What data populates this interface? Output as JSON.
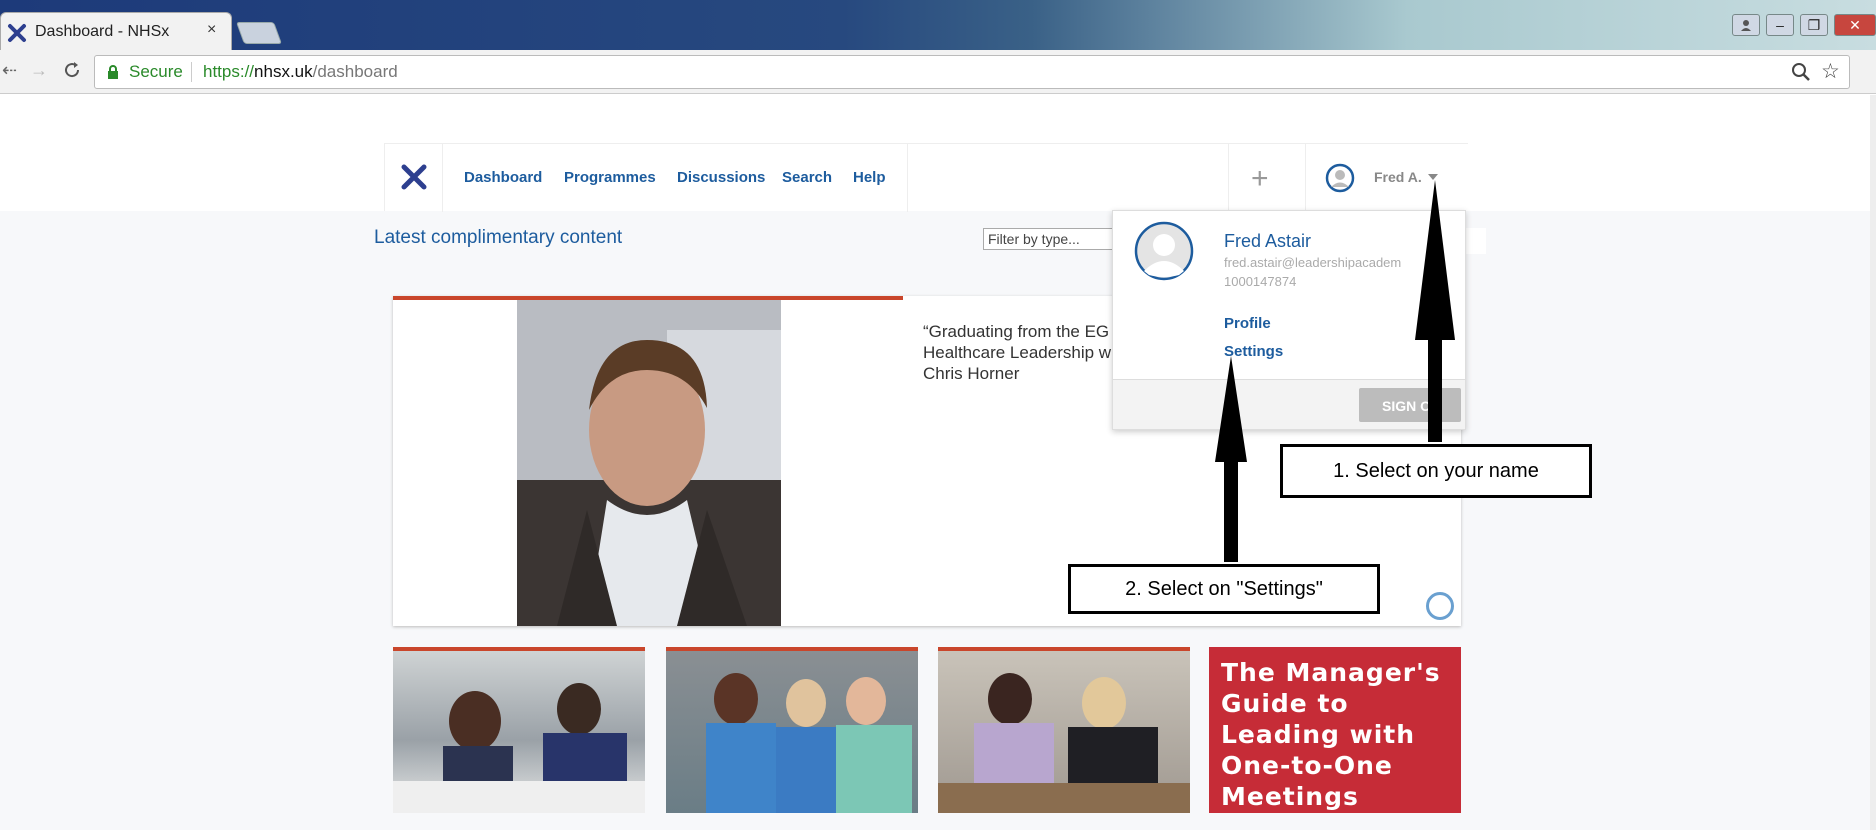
{
  "browser": {
    "tab_title": "Dashboard - NHSx",
    "tab_close": "×",
    "secure_label": "Secure",
    "url_scheme": "https://",
    "url_host": "nhsx.uk",
    "url_path": "/dashboard"
  },
  "nav": {
    "items": [
      "Dashboard",
      "Programmes",
      "Discussions",
      "Search",
      "Help"
    ],
    "add_label": "+",
    "user_short_name": "Fred A."
  },
  "main": {
    "section_title": "Latest complimentary content",
    "filter_placeholder": "Filter by type...",
    "hero_quote_lines": [
      "“Graduating from the EG",
      "Healthcare Leadership w",
      "Chris Horner"
    ],
    "card4_text": "The Manager's Guide to Leading with One-to-One Meetings"
  },
  "user_menu": {
    "name": "Fred Astair",
    "email": "fred.astair@leadershipacadem",
    "id_number": "1000147874",
    "profile_label": "Profile",
    "settings_label": "Settings",
    "sign_out_label": "SIGN OU"
  },
  "annotations": {
    "callout1": "1.  Select on your name",
    "callout2": "2.  Select on \"Settings\""
  },
  "colors": {
    "link_blue": "#1d5c9e",
    "accent_red": "#c9462b",
    "card_red": "#c62c37"
  }
}
